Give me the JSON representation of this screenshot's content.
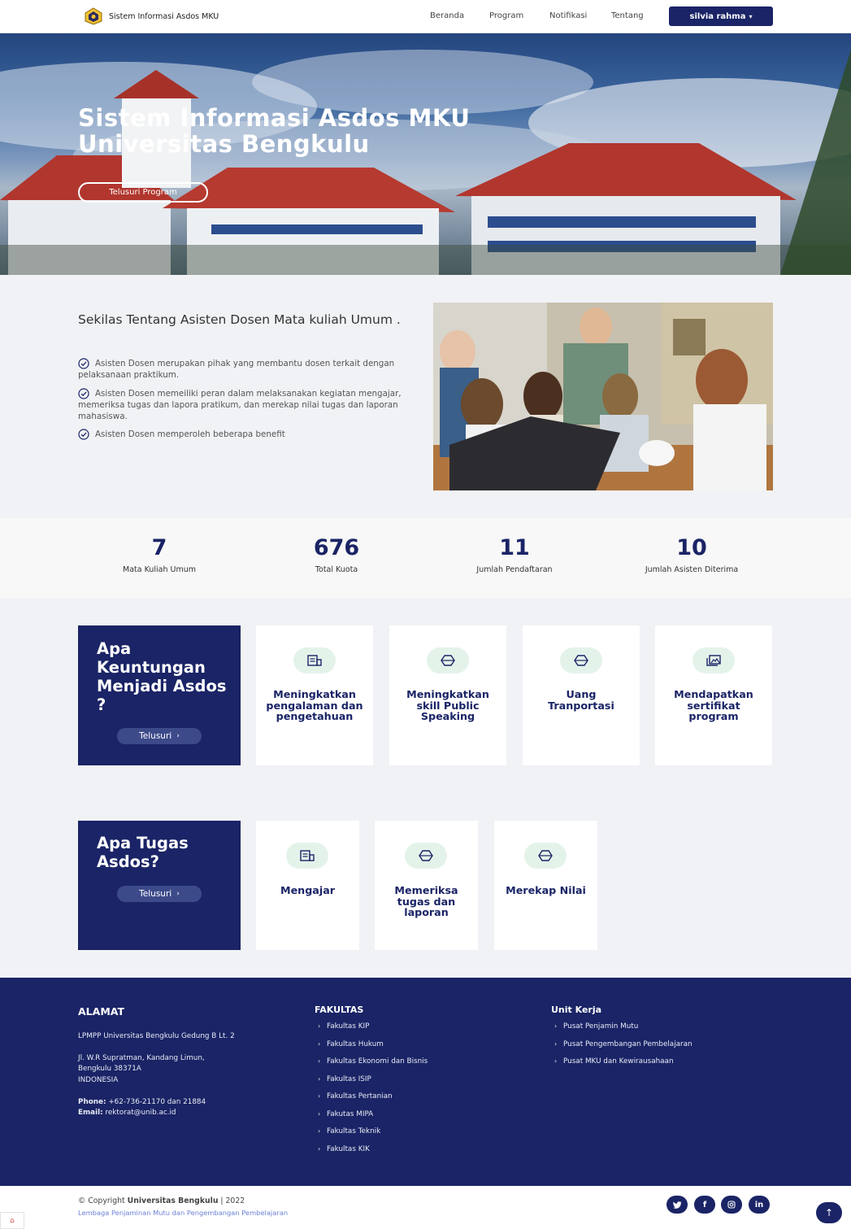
{
  "header": {
    "brand": "Sistem Informasi Asdos MKU",
    "nav": [
      "Beranda",
      "Program",
      "Notifikasi",
      "Tentang"
    ],
    "user": "silvia rahma"
  },
  "hero": {
    "title_line1": "Sistem Informasi Asdos MKU",
    "title_line2": "Universitas Bengkulu",
    "button": "Telusuri Program"
  },
  "about": {
    "title": "Sekilas Tentang Asisten Dosen Mata kuliah Umum .",
    "points": [
      "Asisten Dosen merupakan pihak yang membantu dosen terkait dengan pelaksanaan praktikum.",
      "Asisten Dosen memeiliki peran dalam melaksanakan kegiatan mengajar, memeriksa tugas dan lapora pratikum, dan merekap nilai tugas dan laporan mahasiswa.",
      "Asisten Dosen memperoleh beberapa benefit"
    ]
  },
  "stats": [
    {
      "value": "7",
      "label": "Mata Kuliah Umum"
    },
    {
      "value": "676",
      "label": "Total Kuota"
    },
    {
      "value": "11",
      "label": "Jumlah Pendaftaran"
    },
    {
      "value": "10",
      "label": "Jumlah Asisten Diterima"
    }
  ],
  "benefits": {
    "title": "Apa Keuntungan Menjadi Asdos ?",
    "button": "Telusuri",
    "items": [
      {
        "icon": "receipt-icon",
        "text": "Meningkatkan pengalaman dan pengetahuan"
      },
      {
        "icon": "cube-icon",
        "text": "Meningkatkan skill Public Speaking"
      },
      {
        "icon": "cube-icon",
        "text": "Uang Tranportasi"
      },
      {
        "icon": "images-icon",
        "text": "Mendapatkan sertifikat program"
      }
    ]
  },
  "tasks": {
    "title": "Apa Tugas Asdos?",
    "button": "Telusuri",
    "items": [
      {
        "icon": "receipt-icon",
        "text": "Mengajar"
      },
      {
        "icon": "cube-icon",
        "text": "Memeriksa tugas dan laporan"
      },
      {
        "icon": "cube-icon",
        "text": "Merekap Nilai"
      }
    ]
  },
  "footer": {
    "alamat_title": "ALAMAT",
    "alamat_line1": "LPMPP Universitas Bengkulu Gedung B Lt. 2",
    "alamat_line2": "Jl. W.R Supratman, Kandang Limun,",
    "alamat_line3": "Bengkulu 38371A",
    "alamat_line4": "INDONESIA",
    "phone_label": "Phone:",
    "phone": "+62-736-21170 dan 21884",
    "email_label": "Email:",
    "email": "rektorat@unib.ac.id",
    "fakultas_title": "FAKULTAS",
    "fakultas": [
      "Fakultas KIP",
      "Fakultas Hukum",
      "Fakultas Ekonomi dan Bisnis",
      "Fakultas ISIP",
      "Fakultas Pertanian",
      "Fakutas MIPA",
      "Fakultas Teknik",
      "Fakultas KIK"
    ],
    "unit_title": "Unit Kerja",
    "unit": [
      "Pusat Penjamin Mutu",
      "Pusat Pengembangan Pembelajaran",
      "Pusat MKU dan Kewirausahaan"
    ]
  },
  "bottom": {
    "copy_prefix": "© Copyright",
    "copy_org": "Universitas Bengkulu",
    "copy_year": "| 2022",
    "lpmpp": "Lembaga Penjaminan Mutu dan Pengembangan Pembelajaran",
    "social": [
      "twitter-icon",
      "facebook-icon",
      "instagram-icon",
      "linkedin-icon"
    ]
  }
}
